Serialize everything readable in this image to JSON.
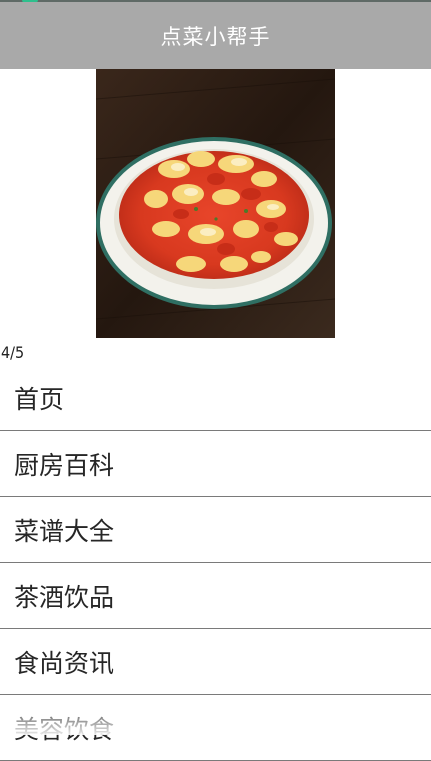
{
  "app": {
    "title": "点菜小帮手"
  },
  "banner": {
    "image_desc": "dish-photo",
    "indicator": "4/5"
  },
  "menu": {
    "items": [
      {
        "label": "首页"
      },
      {
        "label": "厨房百科"
      },
      {
        "label": "菜谱大全"
      },
      {
        "label": "茶酒饮品"
      },
      {
        "label": "食尚资讯"
      },
      {
        "label": "美容饮食"
      }
    ]
  },
  "colors": {
    "appbar": "#a9a9a9",
    "status_accent": "#2fbf8d",
    "divider": "#7a7a7a"
  }
}
